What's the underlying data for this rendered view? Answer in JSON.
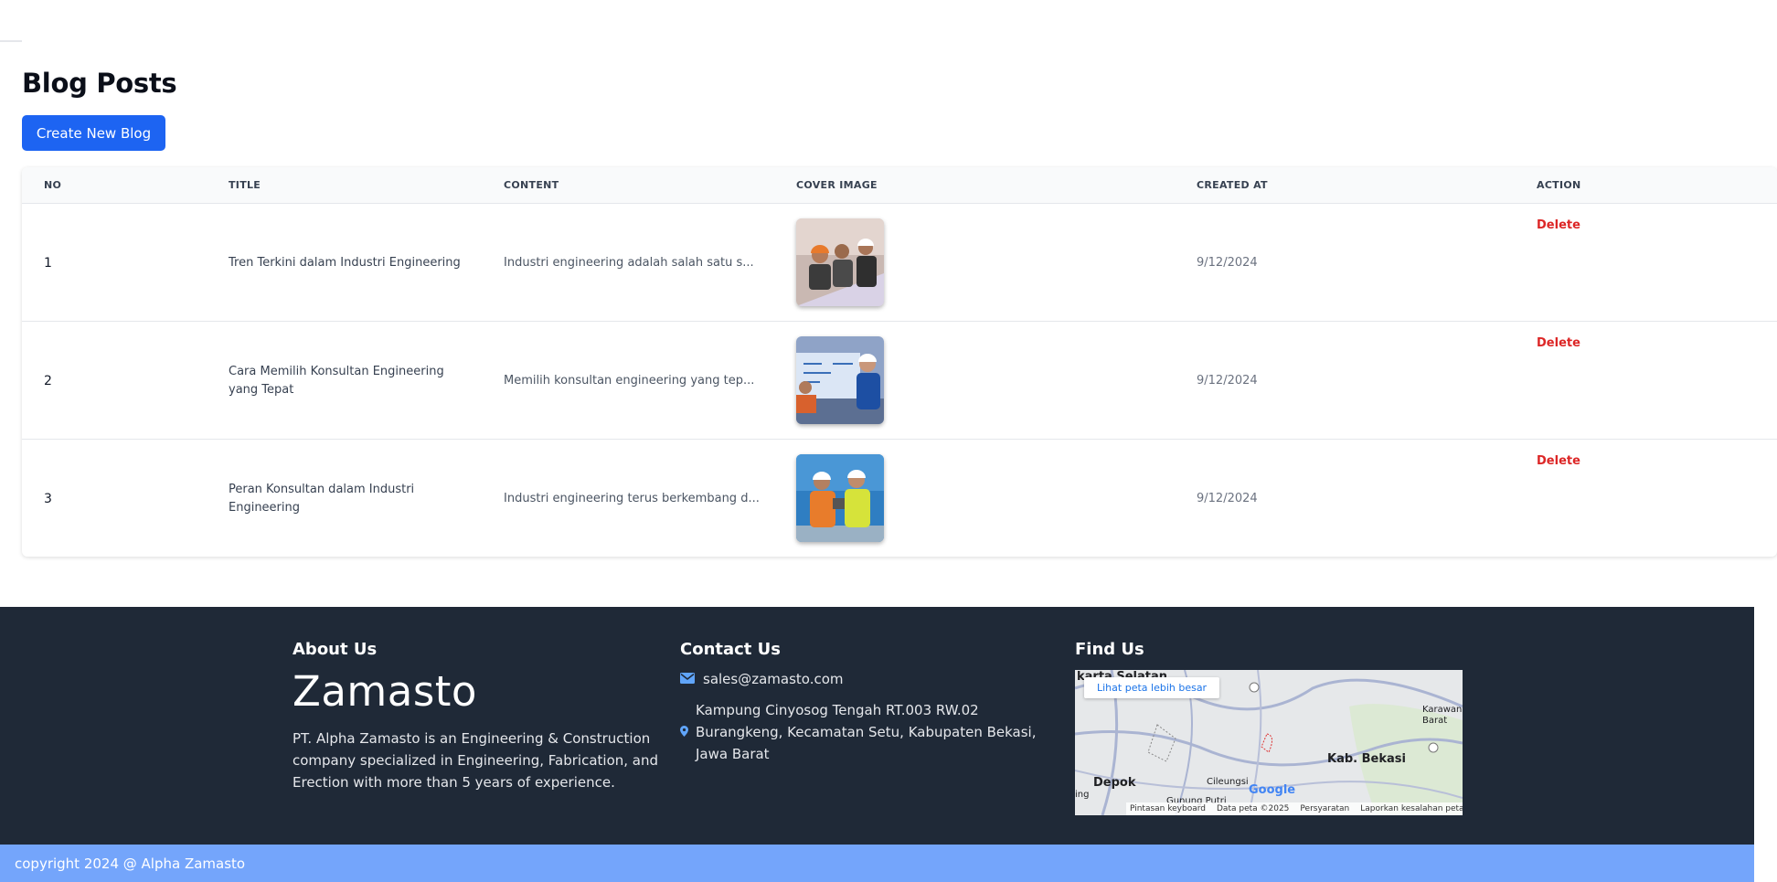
{
  "page": {
    "title": "Blog Posts",
    "create_button": "Create New Blog"
  },
  "table": {
    "headers": [
      "NO",
      "TITLE",
      "CONTENT",
      "COVER IMAGE",
      "CREATED AT",
      "ACTION"
    ],
    "rows": [
      {
        "no": "1",
        "title": "Tren Terkini dalam Industri Engineering",
        "content": "Industri engineering adalah salah satu s...",
        "created_at": "9/12/2024",
        "action": "Delete"
      },
      {
        "no": "2",
        "title": "Cara Memilih Konsultan Engineering yang Tepat",
        "content": "Memilih konsultan engineering yang tep...",
        "created_at": "9/12/2024",
        "action": "Delete"
      },
      {
        "no": "3",
        "title": "Peran Konsultan dalam Industri Engineering",
        "content": "Industri engineering terus berkembang d...",
        "created_at": "9/12/2024",
        "action": "Delete"
      }
    ]
  },
  "footer": {
    "about_heading": "About Us",
    "brand": "Zamasto",
    "about_text": "PT. Alpha Zamasto is an Engineering & Construction company specialized in Engineering, Fabrication, and Erection with more than 5 years of experience.",
    "contact_heading": "Contact Us",
    "email": "sales@zamasto.com",
    "address": "Kampung Cinyosog Tengah RT.003 RW.02 Burangkeng, Kecamatan Setu, Kabupaten Bekasi, Jawa Barat",
    "find_heading": "Find Us",
    "map": {
      "view_larger": "Lihat peta lebih besar",
      "labels": {
        "jaksel": "karta Selatan",
        "karawang": "Karawan Barat",
        "bekasi": "Kab. Bekasi",
        "depok": "Depok",
        "cileungsi": "Cileungsi",
        "gunung_putri": "Gunung Putri",
        "ing": "ing"
      },
      "google": "Google",
      "shortcuts": "Pintasan keyboard",
      "map_data": "Data peta ©2025",
      "terms": "Persyaratan",
      "report": "Laporkan kesalahan peta"
    }
  },
  "copyright": "copyright 2024 @ Alpha Zamasto",
  "colors": {
    "primary": "#1d64f2",
    "delete": "#dc2626",
    "footer_bg": "#1f2937",
    "copyright_bg": "#74a5fb"
  }
}
